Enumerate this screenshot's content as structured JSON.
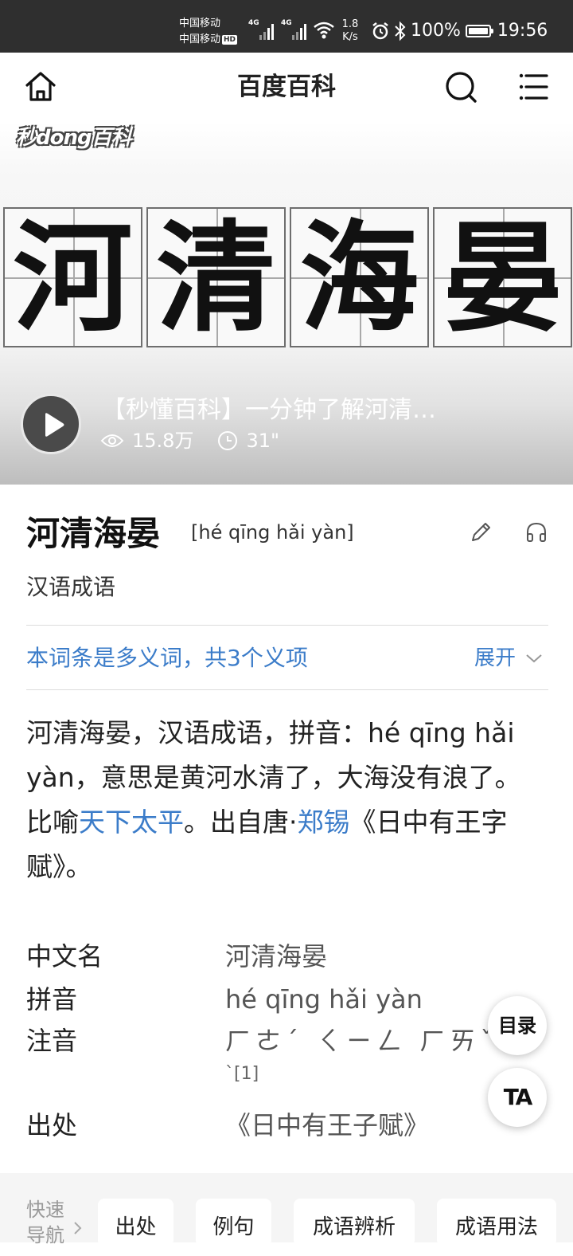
{
  "status_bar": {
    "carrier_1": "中国移动",
    "carrier_2": "中国移动",
    "hd_badge": "HD",
    "net_1": "4G",
    "net_2": "4G",
    "speed_value": "1.8",
    "speed_unit": "K/s",
    "battery": "100%",
    "time": "19:56"
  },
  "header": {
    "title": "百度百科",
    "icons": [
      "home-icon",
      "search-icon",
      "menu-icon"
    ]
  },
  "banner": {
    "logo": "秒dong百科",
    "characters": [
      "河",
      "清",
      "海",
      "晏"
    ],
    "video_title": "【秒懂百科】一分钟了解河清…",
    "views": "15.8万",
    "duration": "31\""
  },
  "entry": {
    "title": "河清海晏",
    "pinyin": "[hé qīng hǎi yàn]",
    "subtitle": "汉语成语",
    "polysemy_text": "本词条是多义词，共3个义项",
    "expand_label": "展开"
  },
  "summary": {
    "part1": "河清海晏，汉语成语，拼音：hé qīng hǎi yàn，意思是黄河水清了，大海没有浪了。比喻",
    "link1": "天下太平",
    "part2": "。出自唐·",
    "link2": "郑锡",
    "part3": "《日中有王字赋》。"
  },
  "info": {
    "rows": [
      {
        "label": "中文名",
        "value": "河清海晏"
      },
      {
        "label": "拼音",
        "value": "hé qīng hǎi yàn"
      },
      {
        "label": "注音",
        "value": "ㄏㄜˊ ㄑㄧㄥ ㄏㄞˇ ㄧㄢ"
      },
      {
        "label": "出处",
        "value": "《日中有王子赋》"
      }
    ],
    "zhuyin_tail": "ˋ[1]"
  },
  "floating": {
    "toc_label": "目录",
    "ta_label": "TA"
  },
  "quick_nav": {
    "label": "快速导航",
    "chips": [
      "出处",
      "例句",
      "成语辨析",
      "成语用法"
    ]
  }
}
